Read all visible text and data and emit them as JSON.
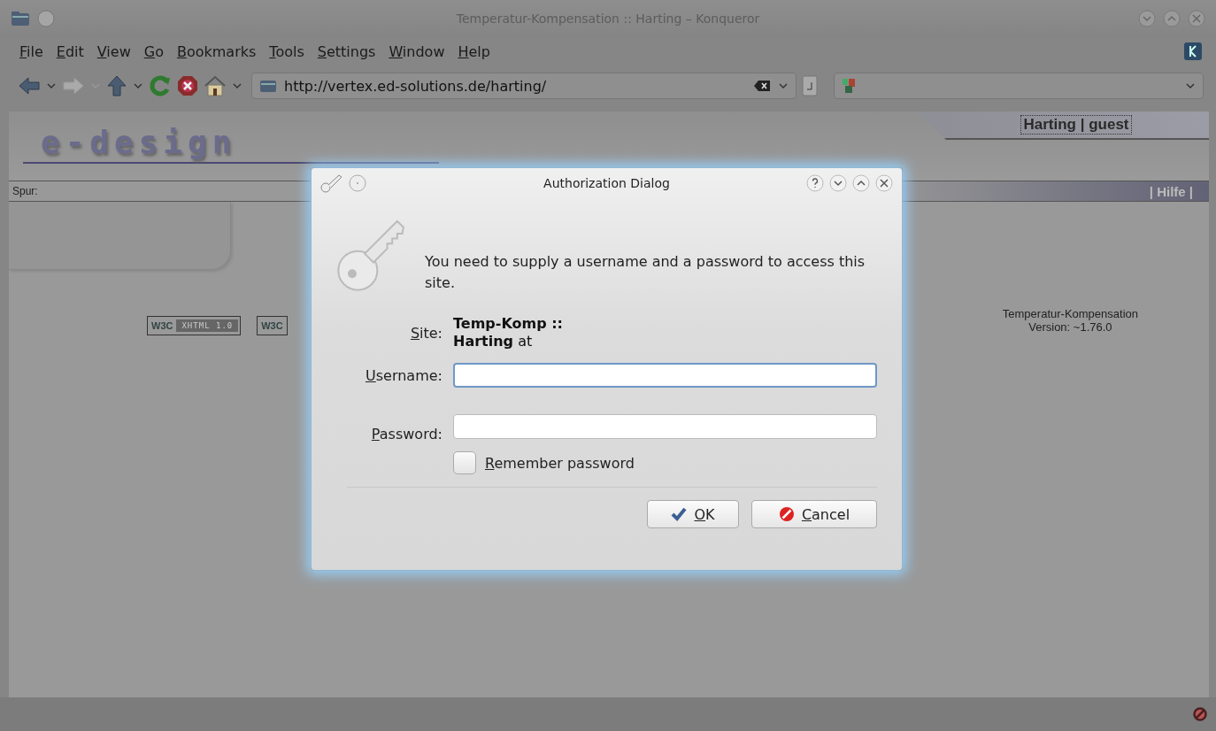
{
  "window": {
    "title": "Temperatur-Kompensation :: Harting – Konqueror"
  },
  "menu": [
    "File",
    "Edit",
    "View",
    "Go",
    "Bookmarks",
    "Tools",
    "Settings",
    "Window",
    "Help"
  ],
  "location": {
    "url": "http://vertex.ed-solutions.de/harting/"
  },
  "page": {
    "logo": "e-design",
    "user_tab": "Harting | guest",
    "trail_label": "Spur:",
    "help_link": "| Hilfe |",
    "badges": [
      {
        "mark": "W3C",
        "label": "XHTML 1.0"
      },
      {
        "mark": "W3C"
      }
    ],
    "app_name": "Temperatur-Kompensation",
    "version": "Version: ~1.76.0"
  },
  "dialog": {
    "title": "Authorization Dialog",
    "message": "You need to supply a username and a password to access this site.",
    "site_label": "Site:",
    "site_value": "**Temp-Komp :: Harting** at",
    "fields": [
      {
        "label": "Username:",
        "focused": true
      },
      {
        "label": "Password:",
        "focused": false
      }
    ],
    "remember": {
      "label": "Remember password",
      "checked": false
    },
    "buttons": [
      {
        "label": "OK",
        "kind": "ok"
      },
      {
        "label": "Cancel",
        "kind": "cancel"
      }
    ]
  }
}
